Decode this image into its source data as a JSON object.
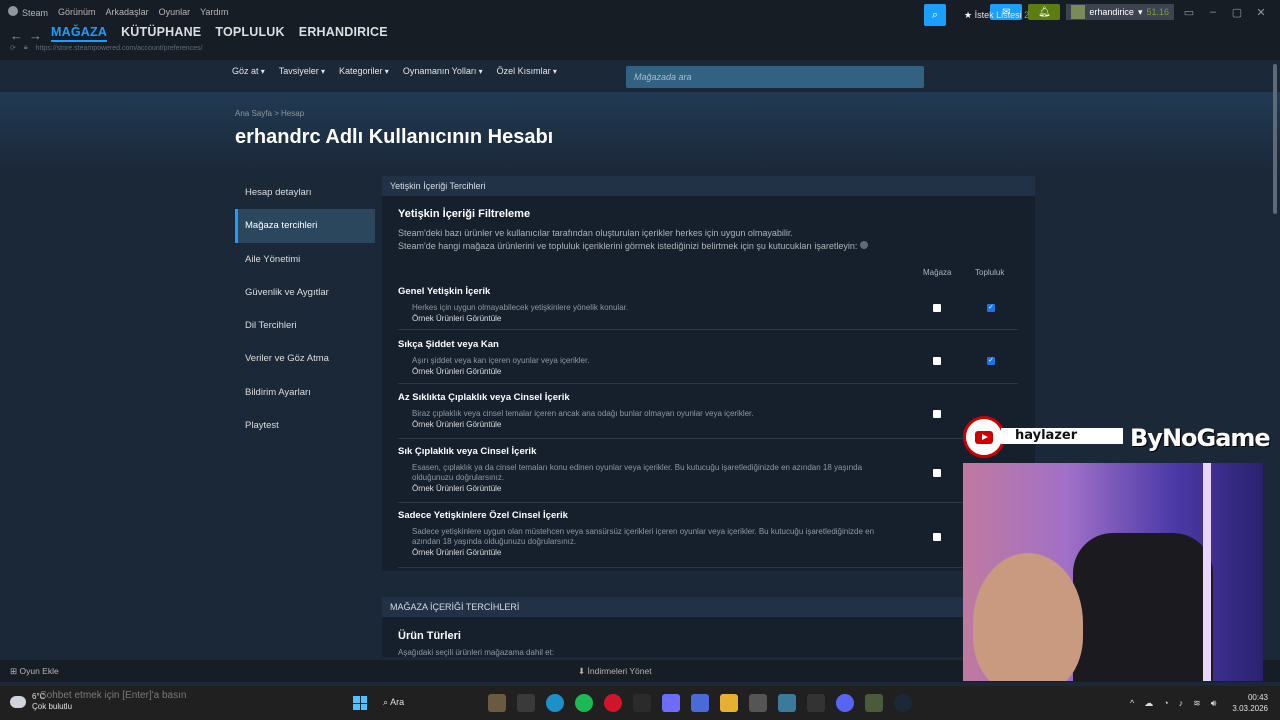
{
  "titlebar": {
    "menu": [
      "Steam",
      "Görünüm",
      "Arkadaşlar",
      "Oyunlar",
      "Yardım"
    ],
    "account_name": "erhandirice",
    "balance": "51.16"
  },
  "nav": {
    "tabs": [
      "MAĞAZA",
      "KÜTÜPHANE",
      "TOPLULUK",
      "ERHANDIRICE"
    ],
    "url": "https://store.steampowered.com/account/preferences/"
  },
  "storenav": {
    "items": [
      "Göz at",
      "Tavsiyeler",
      "Kategoriler",
      "Oynamanın Yolları",
      "Özel Kısımlar"
    ],
    "search_placeholder": "Mağazada ara",
    "wishlist_label": "İstek Listesi",
    "wishlist_count": "2"
  },
  "breadcrumb": "Ana Sayfa > Hesap",
  "page_title": "erhandrc Adlı Kullanıcının Hesabı",
  "leftmenu": [
    "Hesap detayları",
    "Mağaza tercihleri",
    "Aile Yönetimi",
    "Güvenlik ve Aygıtlar",
    "Dil Tercihleri",
    "Veriler ve Göz Atma",
    "Bildirim Ayarları",
    "Playtest"
  ],
  "panel": {
    "header": "Yetişkin İçeriği Tercihleri",
    "title": "Yetişkin İçeriği Filtreleme",
    "desc1": "Steam'deki bazı ürünler ve kullanıcılar tarafından oluşturulan içerikler herkes için uygun olmayabilir.",
    "desc2": "Steam'de hangi mağaza ürünlerini ve topluluk içeriklerini görmek istediğinizi belirtmek için şu kutucukları işaretleyin:",
    "col_store": "Mağaza",
    "col_community": "Topluluk",
    "sample_link": "Örnek Ürünleri Görüntüle",
    "rows": [
      {
        "title": "Genel Yetişkin İçerik",
        "desc": "Herkes için uygun olmayabilecek yetişkinlere yönelik konular.",
        "store": false,
        "community": true
      },
      {
        "title": "Sıkça Şiddet veya Kan",
        "desc": "Aşırı şiddet veya kan içeren oyunlar veya içerikler.",
        "store": false,
        "community": true
      },
      {
        "title": "Az Sıklıkta Çıplaklık veya Cinsel İçerik",
        "desc": "Biraz çıplaklık veya cinsel temalar içeren ancak ana odağı bunlar olmayan oyunlar veya içerikler.",
        "store": false,
        "community": false
      },
      {
        "title": "Sık Çıplaklık veya Cinsel İçerik",
        "desc": "Esasen, çıplaklık ya da cinsel temaları konu edinen oyunlar veya içerikler. Bu kutucuğu işaretlediğinizde en azından 18 yaşında olduğunuzu doğrularsınız.",
        "store": false
      },
      {
        "title": "Sadece Yetişkinlere Özel Cinsel İçerik",
        "desc": "Sadece yetişkinlere uygun olan müstehcen veya sansürsüz içerikleri içeren oyunlar veya içerikler. Bu kutucuğu işaretlediğinizde en azından 18 yaşında olduğunuzu doğrularsınız.",
        "store": false
      }
    ]
  },
  "panel2": {
    "header": "MAĞAZA İÇERİĞİ TERCİHLERİ",
    "title": "Ürün Türleri",
    "sub": "Aşağıdaki seçili ürünleri mağazama dahil et:"
  },
  "bottombar": {
    "add_game": "Oyun Ekle",
    "downloads": "İndirmeleri Yönet"
  },
  "overlay": {
    "name": "haylazer",
    "brand": "ByNoGame"
  },
  "taskbar": {
    "temp": "6°C",
    "weather": "Çok bulutlu",
    "hint": "Sohbet etmek için [Enter]'a basın",
    "search": "Ara",
    "time": "00:43",
    "date": "3.03.2026"
  },
  "colors": {
    "accent": "#1a9fff",
    "background": "#1b2838",
    "checkbox_checked": "#1a73e8"
  }
}
